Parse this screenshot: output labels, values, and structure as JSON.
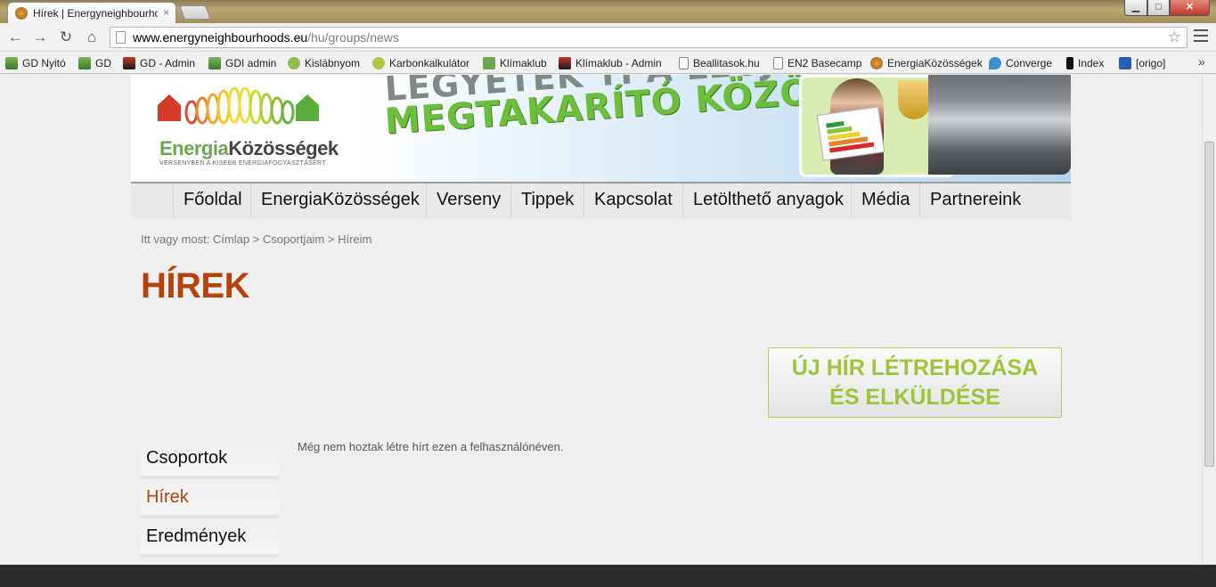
{
  "browser": {
    "tab_title": "Hírek | Energyneighbourho",
    "tab_close": "×",
    "url_host": "www.energyneighbourhoods.eu",
    "url_path": "/hu/groups/news",
    "window_min": "▁",
    "window_max": "□",
    "window_close": "✕",
    "nav_back": "←",
    "nav_forward": "→",
    "nav_reload": "↻",
    "nav_home": "⌂",
    "star": "☆",
    "bookmarks_more": "»"
  },
  "bookmarks": [
    {
      "label": "GD Nyitó",
      "icon": "gd-icon"
    },
    {
      "label": "GD",
      "icon": "gd-icon"
    },
    {
      "label": "GD - Admin",
      "icon": "puzzle-icon"
    },
    {
      "label": "GDI admin",
      "icon": "gd-icon"
    },
    {
      "label": "Kislábnyom",
      "icon": "footprint-icon"
    },
    {
      "label": "Karbonkalkulátor",
      "icon": "co2-icon"
    },
    {
      "label": "Klímaklub",
      "icon": "leaf-icon"
    },
    {
      "label": "Klímaklub - Admin",
      "icon": "puzzle-icon"
    },
    {
      "label": "Beallitasok.hu",
      "icon": "page-icon"
    },
    {
      "label": "EN2 Basecamp",
      "icon": "page-icon"
    },
    {
      "label": "EnergiaKözösségek",
      "icon": "bear-icon"
    },
    {
      "label": "Converge",
      "icon": "drop-icon"
    },
    {
      "label": "Index",
      "icon": "index-icon"
    },
    {
      "label": "[origo]",
      "icon": "origo-icon"
    }
  ],
  "banner": {
    "logo_part1": "Energia",
    "logo_part2": "Közösségek",
    "logo_tagline": "VERSENYBEN A KISEBB ENERGIAFOGYASZTÁSÉRT",
    "slogan_line1": "LEGYETEK TI A LEGJOBB!",
    "slogan_line2": "MEGTAKARÍTÓ KÖZÖSSÉG!"
  },
  "nav": [
    "Főoldal",
    "EnergiaKözösségek",
    "Verseny",
    "Tippek",
    "Kapcsolat",
    "Letölthető anyagok",
    "Média",
    "Partnereink"
  ],
  "breadcrumb": "Itt vagy most: Címlap > Csoportjaim > Híreim",
  "page_title": "HÍREK",
  "cta": {
    "line1": "ÚJ HÍR LÉTREHOZÁSA",
    "line2": "ÉS ELKÜLDÉSE"
  },
  "sidebar": {
    "items": [
      {
        "label": "Csoportok",
        "active": false
      },
      {
        "label": "Hírek",
        "active": true
      },
      {
        "label": "Eredmények",
        "active": false
      }
    ]
  },
  "empty_message": "Még nem hoztak létre hírt ezen a felhasználónéven.",
  "colors": {
    "title": "#b5420d",
    "cta_text": "#9ec43a",
    "slogan_green": "#6cbf3a",
    "logo_green": "#6aa84f"
  }
}
